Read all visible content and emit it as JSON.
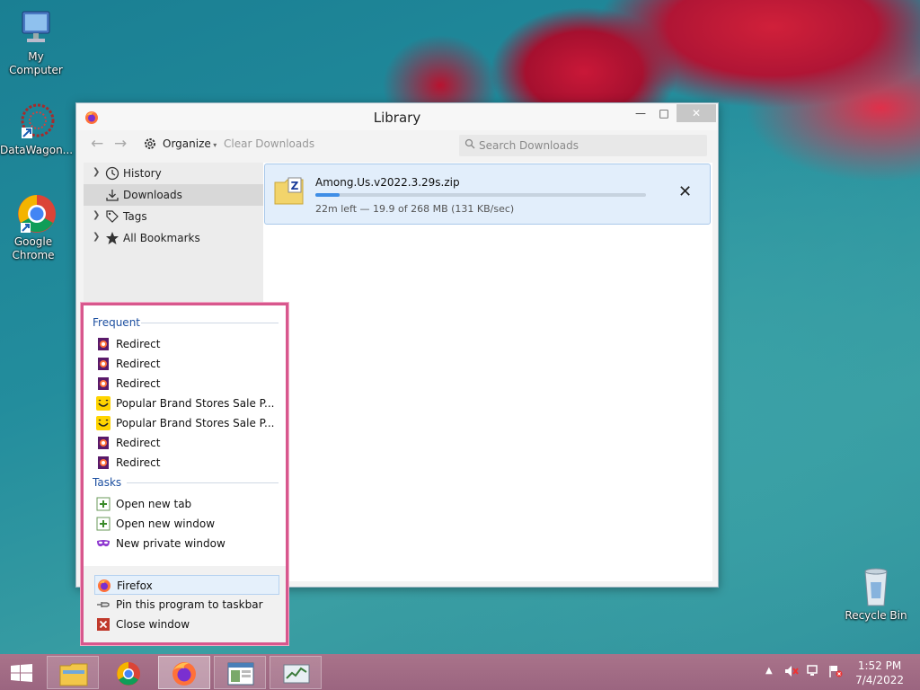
{
  "desktop": {
    "icons": [
      {
        "label": "My Computer"
      },
      {
        "label": "DataWagon..."
      },
      {
        "label": "Google Chrome"
      },
      {
        "label": "Recycle Bin"
      }
    ]
  },
  "window": {
    "title": "Library",
    "toolbar": {
      "organize_label": "Organize",
      "clear_downloads_label": "Clear Downloads",
      "search_placeholder": "Search Downloads"
    },
    "sidebar": {
      "items": [
        {
          "label": "History",
          "icon": "clock-icon"
        },
        {
          "label": "Downloads",
          "icon": "download-icon"
        },
        {
          "label": "Tags",
          "icon": "tag-icon"
        },
        {
          "label": "All Bookmarks",
          "icon": "star-icon"
        }
      ]
    },
    "download": {
      "filename": "Among.Us.v2022.3.29s.zip",
      "status": "22m left — 19.9 of 268 MB (131 KB/sec)",
      "progress": 0.074
    }
  },
  "jumplist": {
    "frequent_header": "Frequent",
    "frequent_items": [
      {
        "label": "Redirect",
        "icon": "redirect-page-icon"
      },
      {
        "label": "Redirect",
        "icon": "redirect-page-icon"
      },
      {
        "label": "Redirect",
        "icon": "redirect-page-icon"
      },
      {
        "label": "Popular Brand Stores Sale P...",
        "icon": "smiley-shop-icon"
      },
      {
        "label": "Popular Brand Stores Sale P...",
        "icon": "smiley-shop-icon"
      },
      {
        "label": "Redirect",
        "icon": "redirect-page-icon"
      },
      {
        "label": "Redirect",
        "icon": "redirect-page-icon"
      }
    ],
    "tasks_header": "Tasks",
    "task_items": [
      {
        "label": "Open new tab",
        "icon": "new-tab-icon"
      },
      {
        "label": "Open new window",
        "icon": "new-window-icon"
      },
      {
        "label": "New private window",
        "icon": "private-mask-icon"
      }
    ],
    "footer_items": [
      {
        "label": "Firefox",
        "icon": "firefox-icon"
      },
      {
        "label": "Pin this program to taskbar",
        "icon": "pin-icon"
      },
      {
        "label": "Close window",
        "icon": "close-window-icon"
      }
    ]
  },
  "taskbar": {
    "time": "1:52 PM",
    "date": "7/4/2022"
  },
  "colors": {
    "jumplist_border": "#d8578d",
    "progress": "#3f8ee6",
    "section_header": "#1c4fa0",
    "taskbar": "#a06b84"
  }
}
